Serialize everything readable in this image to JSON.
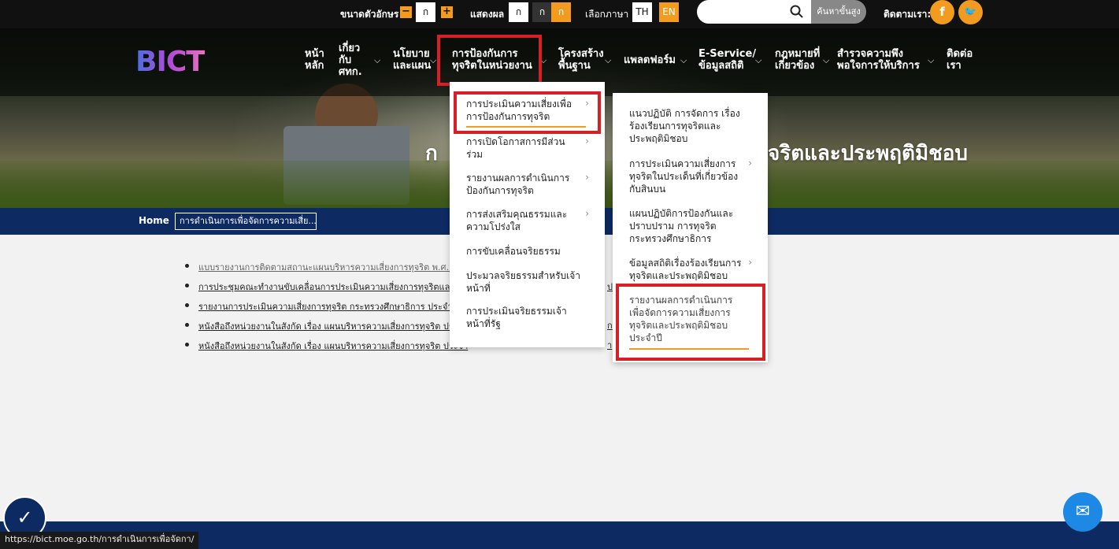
{
  "topbar": {
    "font_size_label": "ขนาดตัวอักษร",
    "font_minus": "−",
    "font_normal": "ก",
    "font_plus": "+",
    "display_label": "แสดงผล",
    "display_options": [
      "ก",
      "ก",
      "ก"
    ],
    "lang_label": "เลือกภาษา",
    "lang_th": "TH",
    "lang_en": "EN",
    "search_placeholder": "",
    "advanced_search": "ค้นหาขั้นสูง",
    "follow_label": "ติดตามเรา:",
    "facebook": "f",
    "twitter": "🐦"
  },
  "logo": "BICT",
  "nav": {
    "home": "หน้า\nหลัก",
    "about": "เกี่ยว\nกับ\nศทก.",
    "policy": "นโยบาย\nและแผน",
    "anti_corruption": "การป้องกันการ\nทุจริตในหน่วยงาน",
    "infrastructure": "โครงสร้าง\nพื้นฐาน",
    "platform": "แพลตฟอร์ม",
    "eservice": "E-Service/\nข้อมูลสถิติ",
    "law": "กฎหมายที่\nเกี่ยวข้อง",
    "survey": "สำรวจความพึง\nพอใจการให้บริการ",
    "contact": "ติดต่อ\nเรา"
  },
  "hero": {
    "title_left": "ก",
    "title_right": "จริตและประพฤติมิชอบ"
  },
  "breadcrumb": {
    "home": "Home",
    "current": "การดำเนินการเพื่อจัดการความเสี่ย..."
  },
  "content": {
    "links": [
      "แบบรายงานการติดตามสถานะแผนบริหารความเสี่ยงการทุจริต พ.ศ.2566",
      "การประชุมคณะทำงานขับเคลื่อนการประเมินความเสี่ยงการทุจริตและประพ",
      "รายงานการประเมินความเสี่ยงการทุจริต กระทรวงศึกษาธิการ ประจำปีงบ",
      "หนังสือถึงหน่วยงานในสังกัด เรื่อง แผนบริหารความเสี่ยงการทุจริต ประจำ",
      "หนังสือถึงหน่วยงานในสังกัด เรื่อง แผนบริหารความเสี่ยงการทุจริต ประจำ"
    ],
    "link_tails": [
      "",
      "ป",
      "",
      "ก",
      "า"
    ]
  },
  "dropdown1": {
    "items": [
      "การประเมินความเสี่ยงเพื่อ\nการป้องกันการทุจริต",
      "การเปิดโอกาสการมีส่วน\nร่วม",
      "รายงานผลการดำเนินการ\nป้องกันการทุจริต",
      "การส่งเสริมคุณธรรมและ\nความโปร่งใส",
      "การขับเคลื่อนจริยธรรม",
      "ประมวลจริยธรรมสำหรับเจ้า\nหน้าที่",
      "การประเมินจริยธรรมเจ้า\nหน้าที่รัฐ"
    ]
  },
  "dropdown2": {
    "items": [
      "แนวปฏิบัติ การจัดการ เรื่อง\nร้องเรียนการทุจริตและ\nประพฤติมิชอบ",
      "การประเมินความเสี่ยงการ\nทุจริตในประเด็นที่เกี่ยวข้อง\nกับสินบน",
      "แผนปฏิบัติการป้องกันและ\nปราบปราม การทุจริต\nกระทรวงศึกษาธิการ",
      "ข้อมูลสถิติเรื่องร้องเรียนการ\nทุจริตและประพฤติมิชอบ",
      "รายงานผลการดำเนินการ\nเพื่อจัดการความเสี่ยงการ\nทุจริตและประพฤติมิชอบ\nประจำปี"
    ]
  },
  "status_url": "https://bict.moe.go.th/การดำเนินการเพื่อจัดกา/",
  "colors": {
    "accent": "#f39b1e",
    "highlight": "#d91f26",
    "navy": "#0d2a63"
  }
}
